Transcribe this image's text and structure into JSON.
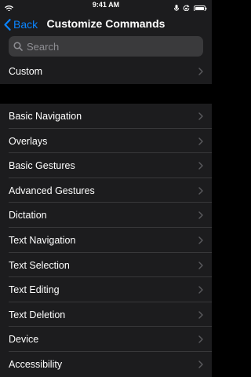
{
  "status_bar": {
    "time": "9:41 AM",
    "icons": [
      "wifi-icon",
      "microphone-icon",
      "rotation-lock-icon",
      "battery-icon"
    ]
  },
  "nav": {
    "back_label": "Back",
    "title": "Customize Commands"
  },
  "search": {
    "placeholder": "Search",
    "value": ""
  },
  "custom_section": {
    "items": [
      {
        "label": "Custom"
      }
    ]
  },
  "commands_section": {
    "items": [
      {
        "label": "Basic Navigation"
      },
      {
        "label": "Overlays"
      },
      {
        "label": "Basic Gestures"
      },
      {
        "label": "Advanced Gestures"
      },
      {
        "label": "Dictation"
      },
      {
        "label": "Text Navigation"
      },
      {
        "label": "Text Selection"
      },
      {
        "label": "Text Editing"
      },
      {
        "label": "Text Deletion"
      },
      {
        "label": "Device"
      },
      {
        "label": "Accessibility"
      }
    ]
  },
  "colors": {
    "accent": "#0a84ff",
    "background": "#000000",
    "cell": "#1c1c1e",
    "separator": "#38383a",
    "chevron": "#5a5a5e"
  }
}
